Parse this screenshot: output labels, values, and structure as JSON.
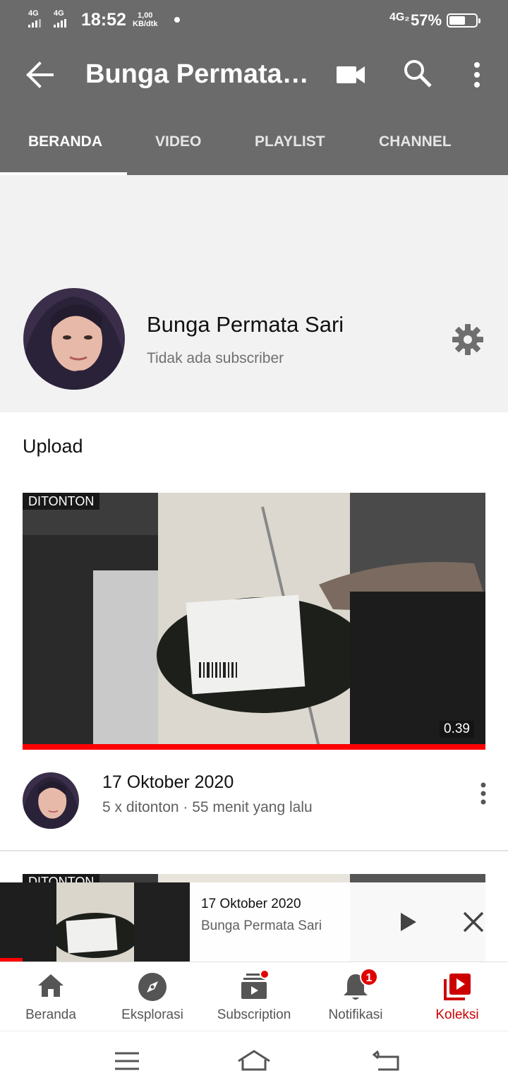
{
  "status_bar": {
    "signal1_label": "4G",
    "signal2_label": "4G",
    "time": "18:52",
    "speed_value": "1,00",
    "speed_unit": "KB/dtk",
    "network_label": "4G₂",
    "battery_percent": "57%"
  },
  "app_bar": {
    "title": "Bunga Permata Sari",
    "icons": [
      "back-arrow-icon",
      "video-camera-icon",
      "search-icon",
      "more-vert-icon"
    ]
  },
  "tabs": [
    {
      "label": "BERANDA",
      "active": true
    },
    {
      "label": "VIDEO",
      "active": false
    },
    {
      "label": "PLAYLIST",
      "active": false
    },
    {
      "label": "CHANNEL",
      "active": false
    }
  ],
  "channel": {
    "name": "Bunga Permata Sari",
    "subscribers": "Tidak ada subscriber"
  },
  "section_title": "Upload",
  "videos": [
    {
      "badge": "DITONTON",
      "duration": "0.39",
      "title": "17 Oktober 2020",
      "meta": "5 x ditonton · 55 menit yang lalu",
      "watched_progress": 1.0
    },
    {
      "badge": "DITONTON"
    }
  ],
  "mini_player": {
    "title": "17 Oktober 2020",
    "channel": "Bunga Permata Sari",
    "progress": 0.05
  },
  "bottom_nav": [
    {
      "label": "Beranda",
      "icon": "home-icon",
      "active": false
    },
    {
      "label": "Eksplorasi",
      "icon": "compass-icon",
      "active": false
    },
    {
      "label": "Subscription",
      "icon": "subscriptions-icon",
      "active": false
    },
    {
      "label": "Notifikasi",
      "icon": "bell-icon",
      "active": false,
      "badge": "1"
    },
    {
      "label": "Koleksi",
      "icon": "library-icon",
      "active": true
    }
  ],
  "colors": {
    "appbar": "#6b6b6b",
    "accent": "#ff0000",
    "active_nav": "#cc0000"
  }
}
